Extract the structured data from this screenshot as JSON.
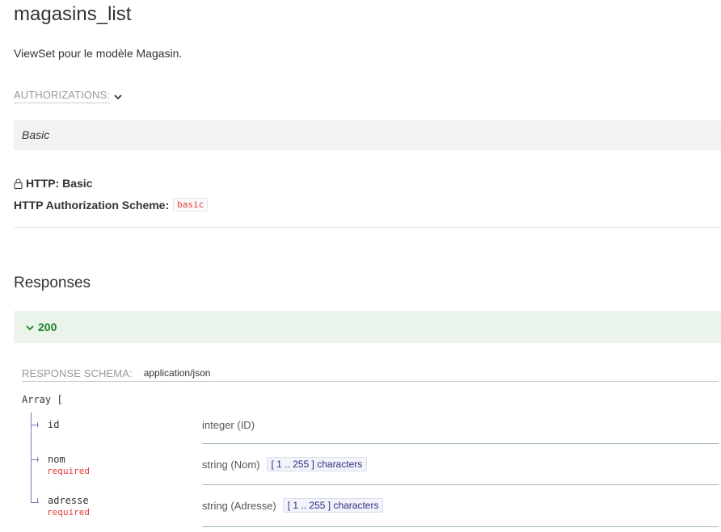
{
  "operation": {
    "title": "magasins_list",
    "description": "ViewSet pour le modèle Magasin."
  },
  "authorizations": {
    "label": "AUTHORIZATIONS:",
    "scheme_tab": "Basic",
    "http_title": "HTTP: Basic",
    "scheme_label": "HTTP Authorization Scheme:",
    "scheme_value": "basic",
    "icons": {
      "toggle": "chevron-down-icon",
      "lock": "lock-icon"
    }
  },
  "responses": {
    "title": "Responses",
    "items": [
      {
        "code": "200",
        "expanded": true,
        "color": "#1d8127",
        "background": "#eaf4ea"
      }
    ],
    "schema": {
      "label": "RESPONSE SCHEMA:",
      "content_type": "application/json",
      "array_open": "Array [",
      "properties": [
        {
          "name": "id",
          "required": "",
          "type": "integer (ID)",
          "constraint": ""
        },
        {
          "name": "nom",
          "required": "required",
          "type": "string (Nom)",
          "constraint": "[ 1 .. 255 ] characters"
        },
        {
          "name": "adresse",
          "required": "required",
          "type": "string (Adresse)",
          "constraint": "[ 1 .. 255 ] characters"
        }
      ]
    }
  },
  "colors": {
    "required": "#e53935",
    "success": "#1d8127",
    "constraint_text": "#2a2f82"
  }
}
